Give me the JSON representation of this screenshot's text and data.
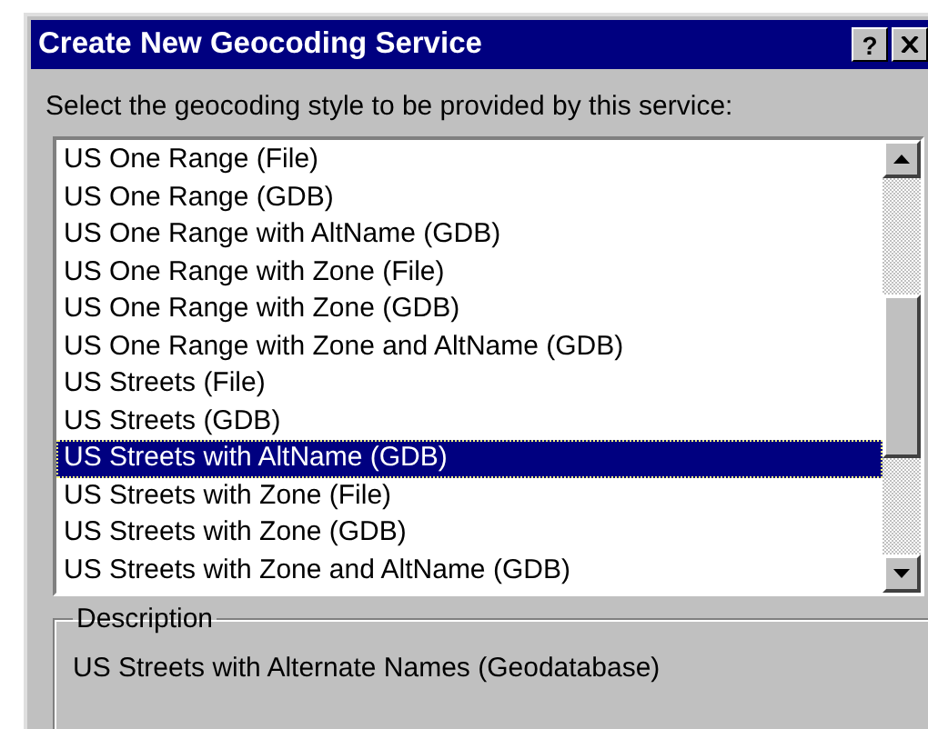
{
  "window": {
    "title": "Create New Geocoding Service",
    "help_button": "?"
  },
  "prompt": "Select the geocoding style to be provided by this service:",
  "styles": [
    {
      "label": "US One Range (File)",
      "selected": false
    },
    {
      "label": "US One Range (GDB)",
      "selected": false
    },
    {
      "label": "US One Range with AltName (GDB)",
      "selected": false
    },
    {
      "label": "US One Range with Zone (File)",
      "selected": false
    },
    {
      "label": "US One Range with Zone (GDB)",
      "selected": false
    },
    {
      "label": "US One Range with Zone and AltName (GDB)",
      "selected": false
    },
    {
      "label": "US Streets (File)",
      "selected": false
    },
    {
      "label": "US Streets (GDB)",
      "selected": false
    },
    {
      "label": "US Streets with AltName (GDB)",
      "selected": true
    },
    {
      "label": "US Streets with Zone (File)",
      "selected": false
    },
    {
      "label": "US Streets with Zone (GDB)",
      "selected": false
    },
    {
      "label": "US Streets with Zone and AltName (GDB)",
      "selected": false
    }
  ],
  "description": {
    "title": "Description",
    "text": "US Streets with Alternate Names (Geodatabase)"
  }
}
